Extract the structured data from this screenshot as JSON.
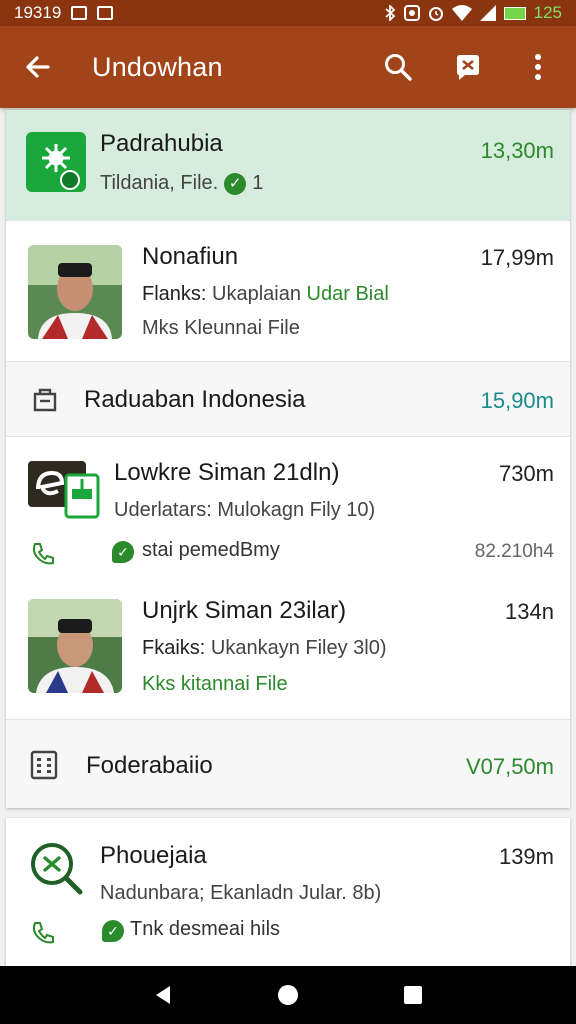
{
  "status_bar": {
    "time": "19319",
    "right_time": "125",
    "left_icons": [
      "notification-box-icon",
      "notification-box-icon"
    ],
    "right_icons": [
      "bluetooth-icon",
      "nfc-icon",
      "alarm-icon",
      "wifi-icon",
      "signal-icon",
      "battery-icon"
    ]
  },
  "app_bar": {
    "title": "Undowhan",
    "back_icon": "arrow-left-icon",
    "search_icon": "search-icon",
    "chat_icon": "chat-icon",
    "menu_icon": "more-vert-icon"
  },
  "list": [
    {
      "name": "Padrahubia",
      "subtitle": "Tildania, File.",
      "badge": "1",
      "time": "13,30m",
      "highlighted": true,
      "icon": "app-logo-icon"
    },
    {
      "name": "Nonafiun",
      "subtitle_prefix": "Flanks:",
      "subtitle_main": "Ukaplaian",
      "subtitle_accent": "Udar Bial",
      "subtitle2": "Mks Kleunnai File",
      "time": "17,99m",
      "avatar": "person-avatar"
    },
    {
      "name": "Raduaban Indonesia",
      "time": "15,90m",
      "icon": "shopping-bag-icon"
    },
    {
      "name": "Lowkre Siman 21dln)",
      "subtitle": "Uderlatars: Mulokagn Fily 10)",
      "extra": "stai pemedBmy",
      "extra_time": "82.210h4",
      "time": "730m",
      "icon": "file-logo-icon"
    },
    {
      "name": "Unjrk Siman 23ilar)",
      "subtitle_prefix": "Fkaiks:",
      "subtitle_main": "Ukankayn Filey 3l0)",
      "subtitle2": "Kks kitannai File",
      "time": "134n",
      "avatar": "person-avatar"
    },
    {
      "name": "Foderabaiio",
      "time": "V07,50m",
      "icon": "calculator-icon"
    }
  ],
  "card2": {
    "name": "Phouejaia",
    "subtitle": "Nadunbara; Ekanladn Jular. 8b)",
    "extra": "Tnk desmeai hils",
    "time": "139m",
    "icon": "search-logo-icon"
  },
  "nav": {
    "back": "triangle-back-icon",
    "home": "circle-home-icon",
    "recents": "square-recents-icon"
  },
  "colors": {
    "app_bar": "#a1441a",
    "status_bar": "#8a3410",
    "highlight": "#d6ecdc",
    "accent_green": "#2b8a2b",
    "accent_teal": "#1a8a8a"
  }
}
